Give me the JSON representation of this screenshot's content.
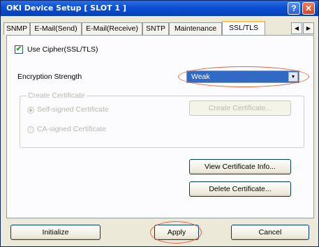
{
  "window": {
    "title": "OKI Device Setup [ SLOT 1 ]",
    "help_label": "?",
    "close_label": "✕"
  },
  "tabs": [
    {
      "label": "SNMP"
    },
    {
      "label": "E-Mail(Send)"
    },
    {
      "label": "E-Mail(Receive)"
    },
    {
      "label": "SNTP"
    },
    {
      "label": "Maintenance"
    },
    {
      "label": "SSL/TLS",
      "active": true
    }
  ],
  "tab_scroll": {
    "left": "◀",
    "right": "▶"
  },
  "ssl": {
    "use_cipher_label": "Use Cipher(SSL/TLS)",
    "use_cipher_checked": true,
    "check_mark": "✔",
    "encryption_label": "Encryption Strength",
    "encryption_value": "Weak",
    "dropdown_arrow": "▼"
  },
  "create_certificate": {
    "group_title": "Create Certificate",
    "self_signed_label": "Self-signed Certificate",
    "self_signed_selected": true,
    "ca_signed_label": "CA-signed Certificate",
    "create_button": "Create Certificate..."
  },
  "cert_buttons": {
    "view_info": "View Certificate Info...",
    "delete": "Delete Certificate..."
  },
  "footer": {
    "initialize": "Initialize",
    "apply": "Apply",
    "cancel": "Cancel"
  },
  "highlight_color": "#e8643c"
}
